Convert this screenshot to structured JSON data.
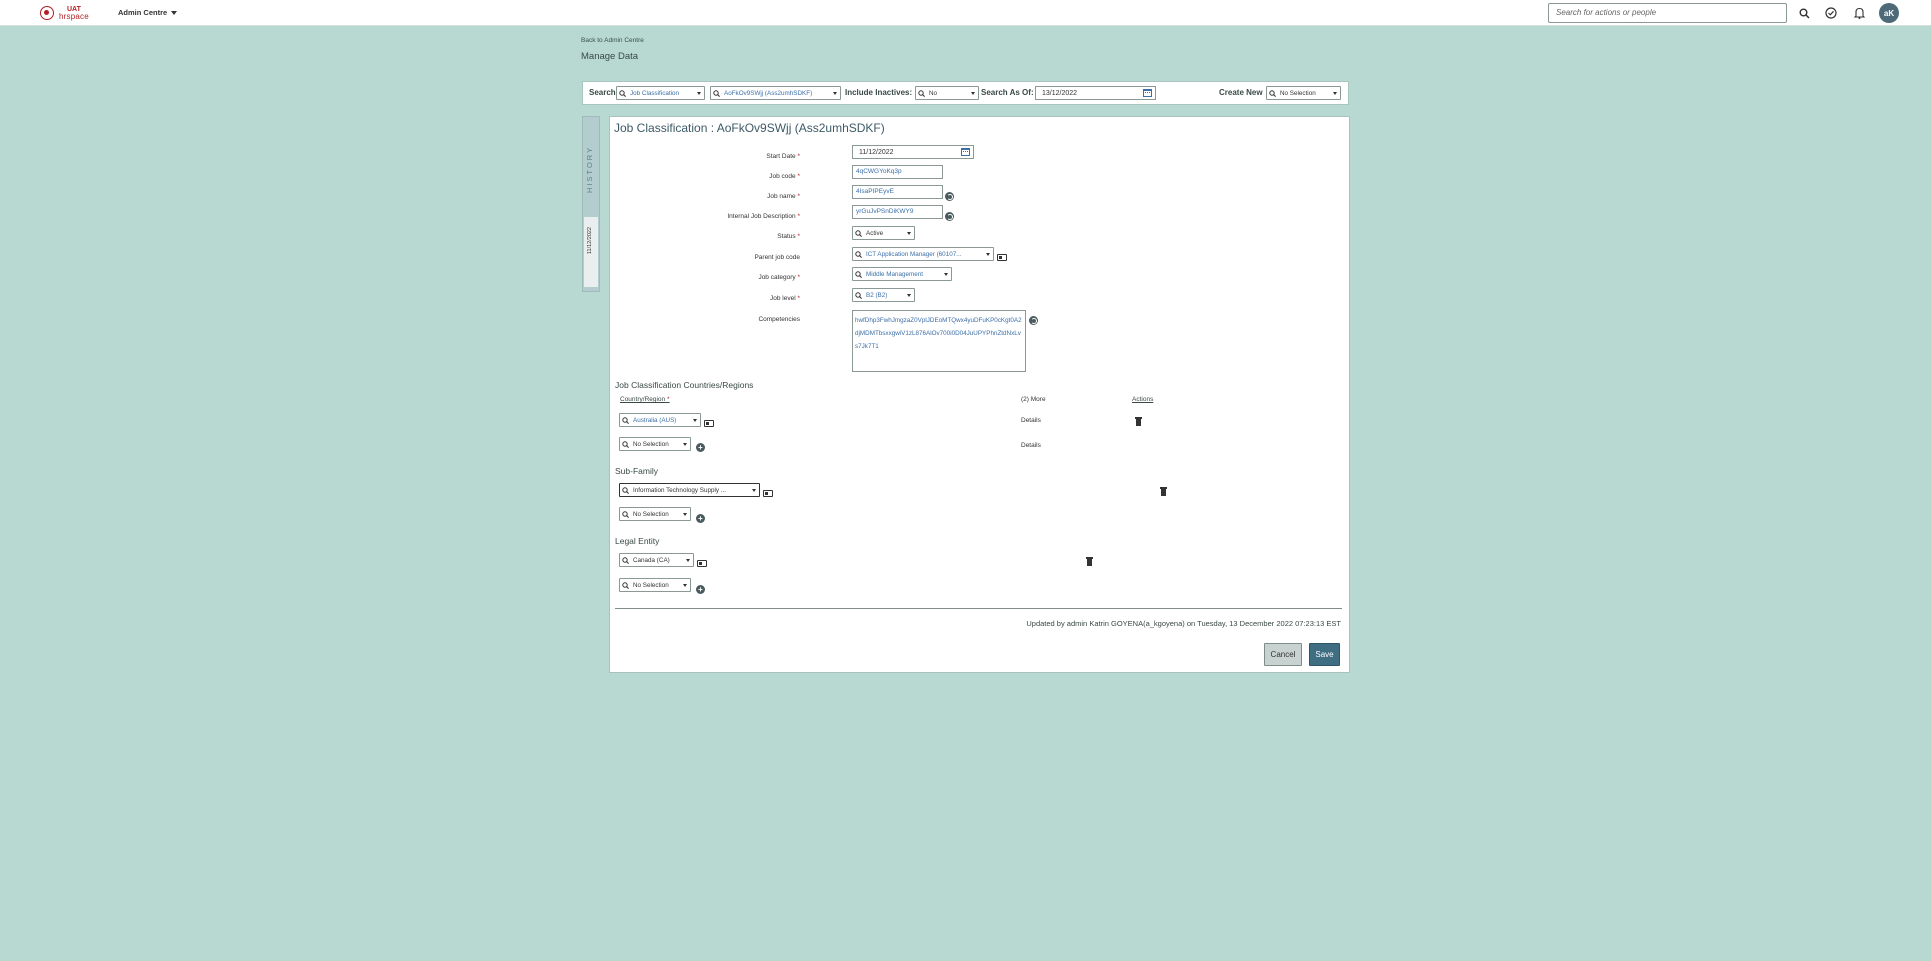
{
  "header": {
    "logo_uat": "UAT",
    "logo_brand": "hrspace",
    "admin_menu": "Admin Centre",
    "search_placeholder": "Search for actions or people",
    "avatar_initials": "aK"
  },
  "breadcrumb": {
    "back": "Back to Admin Centre"
  },
  "page_title": "Manage Data",
  "searchbar": {
    "search_label": "Search",
    "object_type": "Job Classification",
    "object_value": "AoFkOv9SWjj (Ass2umhSDKF)",
    "include_inactives_label": "Include Inactives:",
    "include_inactives_value": "No",
    "search_as_of_label": "Search As Of:",
    "search_as_of_value": "13/12/2022",
    "create_new_label": "Create New",
    "create_new_value": "No Selection"
  },
  "history": {
    "label": "HISTORY",
    "date": "11/12/2022"
  },
  "form": {
    "title": "Job Classification : AoFkOv9SWjj (Ass2umhSDKF)",
    "start_date_label": "Start Date",
    "start_date": "11/12/2022",
    "job_code_label": "Job code",
    "job_code": "4qCWGYoKq3p",
    "job_name_label": "Job name",
    "job_name": "4IsaPIPEyvE",
    "internal_desc_label": "Internal Job Description",
    "internal_desc": "yrGuJvPSnDiKWY9",
    "status_label": "Status",
    "status": "Active",
    "parent_job_label": "Parent job code",
    "parent_job": "ICT Application Manager (60107...",
    "job_category_label": "Job category",
    "job_category": "Middle Management",
    "job_level_label": "Job level",
    "job_level": "B2 (B2)",
    "competencies_label": "Competencies",
    "competencies": "hwfDhp3FwhJmgzaZ0VplJDEoMTQwx4yuDFuKP0cKgt0A2djMDMTbsxxgwiV1zL876AlOv700i0D04JuUPYPhnZtdNxLvs7Jk7T1"
  },
  "countries": {
    "title": "Job Classification Countries/Regions",
    "col_country": "Country/Region",
    "col_more": "(2) More",
    "col_actions": "Actions",
    "row1_value": "Australia (AUS)",
    "row2_value": "No Selection",
    "details": "Details"
  },
  "subfamily": {
    "title": "Sub-Family",
    "row1_value": "Information Technology Supply ...",
    "row2_value": "No Selection"
  },
  "legal_entity": {
    "title": "Legal Entity",
    "row1_value": "Canada (CA)",
    "row2_value": "No Selection"
  },
  "footer": {
    "updated": "Updated by admin Katrin GOYENA(a_kgoyena) on Tuesday, 13 December 2022 07:23:13 EST",
    "cancel": "Cancel",
    "save": "Save"
  },
  "colors": {
    "background": "#b8d8d2",
    "primary": "#3f6d82",
    "link": "#3c6fa8",
    "brand": "#b21f24"
  }
}
